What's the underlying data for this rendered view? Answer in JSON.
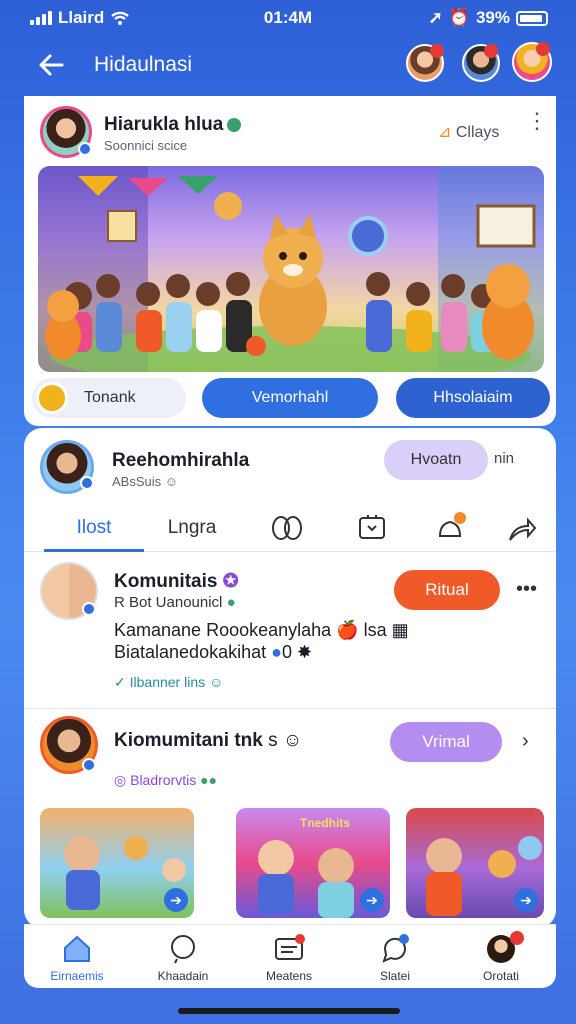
{
  "status": {
    "carrier": "Llaird",
    "time": "01:4M",
    "battery": "39%"
  },
  "appbar": {
    "title": "Hidaulnasi"
  },
  "header_card": {
    "name": "Hiarukla hlua",
    "subtitle": "Soonnici scice",
    "chats_label": "Cllays",
    "btn_left": "Tonank",
    "btn_mid": "Vemorhahl",
    "btn_right": "Hhsolaiaim"
  },
  "profile": {
    "name": "Reehomhirahla",
    "sub": "ABsSuis",
    "follow_label": "Hvoatn",
    "follow_extra": "nin"
  },
  "tabs": {
    "post": "Ilost",
    "second": "Lngra"
  },
  "post1": {
    "name": "Komunitais",
    "meta": "R  Bot Uanounicl",
    "action": "Ritual",
    "line1": "Kamanane Roookeanylaha",
    "line1_tail": "lsa",
    "line2": "Biatalanedokakihat",
    "line2_tail": "0",
    "link": "Ilbanner lins"
  },
  "post2": {
    "name": "Kiomumitani tnk",
    "name_tail": "s",
    "action": "Vrimal",
    "link": "Bladrorvtis"
  },
  "thumbs": [
    {
      "caption": ""
    },
    {
      "caption": "Tnedhits"
    },
    {
      "caption": ""
    }
  ],
  "nav": [
    {
      "label": "Eirnaemis"
    },
    {
      "label": "Khaadain"
    },
    {
      "label": "Meatens"
    },
    {
      "label": "Slatei"
    },
    {
      "label": "Orotati"
    }
  ],
  "colors": {
    "accent": "#2f6fe0",
    "orange": "#f05a28",
    "purple": "#b58df0"
  }
}
